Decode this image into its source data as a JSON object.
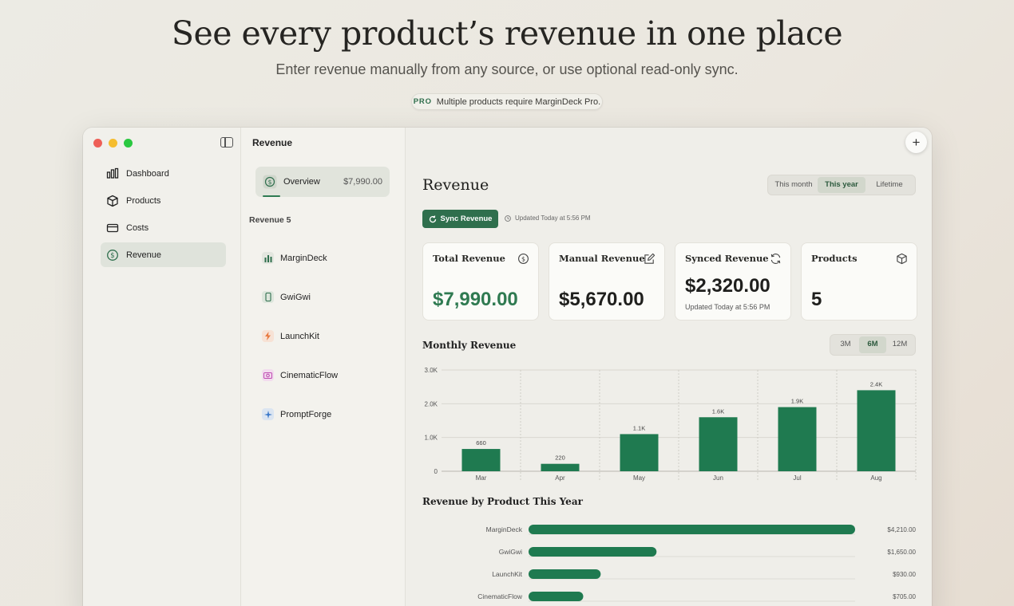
{
  "hero": {
    "title": "See every product’s revenue in one place",
    "subtitle": "Enter revenue manually from any source, or use optional read-only sync.",
    "pro_tag": "PRO",
    "pro_text": "Multiple products require MarginDeck Pro."
  },
  "colors": {
    "accent": "#2f6f4d",
    "bar": "#1f7a50",
    "red": "#ee5f57",
    "yellow": "#f5bd2f",
    "green": "#2ac840"
  },
  "sidebar": {
    "items": [
      {
        "label": "Dashboard",
        "icon": "bar-chart-icon",
        "active": false
      },
      {
        "label": "Products",
        "icon": "box-icon",
        "active": false
      },
      {
        "label": "Costs",
        "icon": "card-icon",
        "active": false
      },
      {
        "label": "Revenue",
        "icon": "dollar-icon",
        "active": true
      }
    ]
  },
  "midcol": {
    "title": "Revenue",
    "overview_label": "Overview",
    "overview_value": "$7,990.00",
    "products_header": "Revenue  5",
    "products": [
      {
        "name": "MarginDeck",
        "icon": "chart-icon",
        "color": "#e3e6df"
      },
      {
        "name": "GwiGwi",
        "icon": "phone-icon",
        "color": "#dde6dc"
      },
      {
        "name": "LaunchKit",
        "icon": "bolt-icon",
        "color": "#f7e2d5"
      },
      {
        "name": "CinematicFlow",
        "icon": "camera-icon",
        "color": "#f2dcee"
      },
      {
        "name": "PromptForge",
        "icon": "sparkle-icon",
        "color": "#dbe5f1"
      }
    ]
  },
  "main": {
    "title": "Revenue",
    "range_options": [
      "This month",
      "This year",
      "Lifetime"
    ],
    "range_selected": "This year",
    "sync_label": "Sync Revenue",
    "updated_note": "Updated Today at 5:56 PM",
    "cards": [
      {
        "title": "Total Revenue",
        "value": "$7,990.00",
        "sub": "",
        "icon": "dollar-icon"
      },
      {
        "title": "Manual Revenue",
        "value": "$5,670.00",
        "sub": "",
        "icon": "edit-icon"
      },
      {
        "title": "Synced Revenue",
        "value": "$2,320.00",
        "sub": "Updated Today at 5:56 PM",
        "icon": "refresh-icon"
      },
      {
        "title": "Products",
        "value": "5",
        "sub": "",
        "icon": "box-icon"
      }
    ],
    "monthly_title": "Monthly Revenue",
    "period_options": [
      "3M",
      "6M",
      "12M"
    ],
    "period_selected": "6M",
    "by_product_title": "Revenue by Product This Year"
  },
  "chart_data": [
    {
      "type": "bar",
      "title": "Monthly Revenue",
      "categories": [
        "Mar",
        "Apr",
        "May",
        "Jun",
        "Jul",
        "Aug"
      ],
      "values": [
        660,
        220,
        1100,
        1600,
        1900,
        2400
      ],
      "value_labels": [
        "660",
        "220",
        "1.1K",
        "1.6K",
        "1.9K",
        "2.4K"
      ],
      "yticks": [
        "0",
        "1.0K",
        "2.0K",
        "3.0K"
      ],
      "ylim": [
        0,
        3000
      ],
      "grid": true
    },
    {
      "type": "bar",
      "orientation": "horizontal",
      "title": "Revenue by Product This Year",
      "categories": [
        "MarginDeck",
        "GwiGwi",
        "LaunchKit",
        "CinematicFlow"
      ],
      "values": [
        4210,
        1650,
        930,
        705
      ],
      "value_labels": [
        "$4,210.00",
        "$1,650.00",
        "$930.00",
        "$705.00"
      ]
    }
  ]
}
